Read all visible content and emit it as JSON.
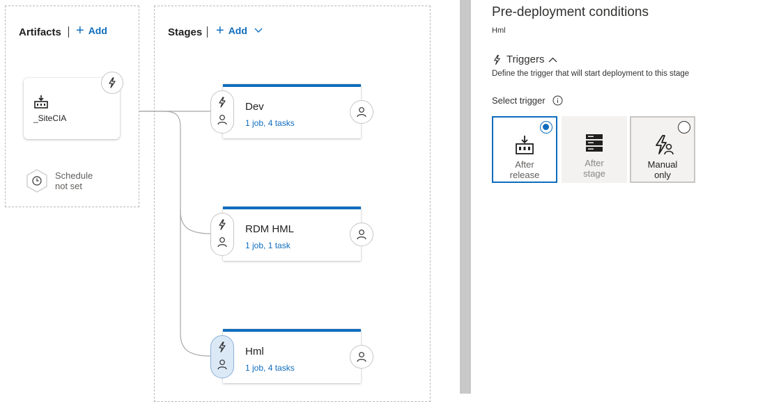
{
  "artifacts": {
    "header": "Artifacts",
    "add_label": "Add",
    "artifact_name": "_SiteCIA",
    "schedule_line1": "Schedule",
    "schedule_line2": "not set"
  },
  "stages": {
    "header": "Stages",
    "add_label": "Add",
    "items": [
      {
        "name": "Dev",
        "summary": "1 job, 4 tasks"
      },
      {
        "name": "RDM HML",
        "summary": "1 job, 1 task"
      },
      {
        "name": "Hml",
        "summary": "1 job, 4 tasks"
      }
    ]
  },
  "panel": {
    "title": "Pre-deployment conditions",
    "subtitle": "Hml",
    "triggers_label": "Triggers",
    "triggers_desc": "Define the trigger that will start deployment to this stage",
    "select_trigger_label": "Select trigger",
    "options": [
      {
        "line1": "After",
        "line2": "release",
        "selected": true
      },
      {
        "line1": "After",
        "line2": "stage",
        "selected": false
      },
      {
        "line1": "Manual",
        "line2": "only",
        "selected": false
      }
    ]
  },
  "colors": {
    "accent": "#0f6cbd",
    "selected_stage_bg": "#dbe9f7",
    "divider": "#c8c8c8"
  },
  "icons": [
    "plus-icon",
    "chevron-down-icon",
    "lightning-icon",
    "build-artifact-icon",
    "clock-icon",
    "person-icon",
    "info-icon",
    "server-icon",
    "lightning-person-icon"
  ]
}
